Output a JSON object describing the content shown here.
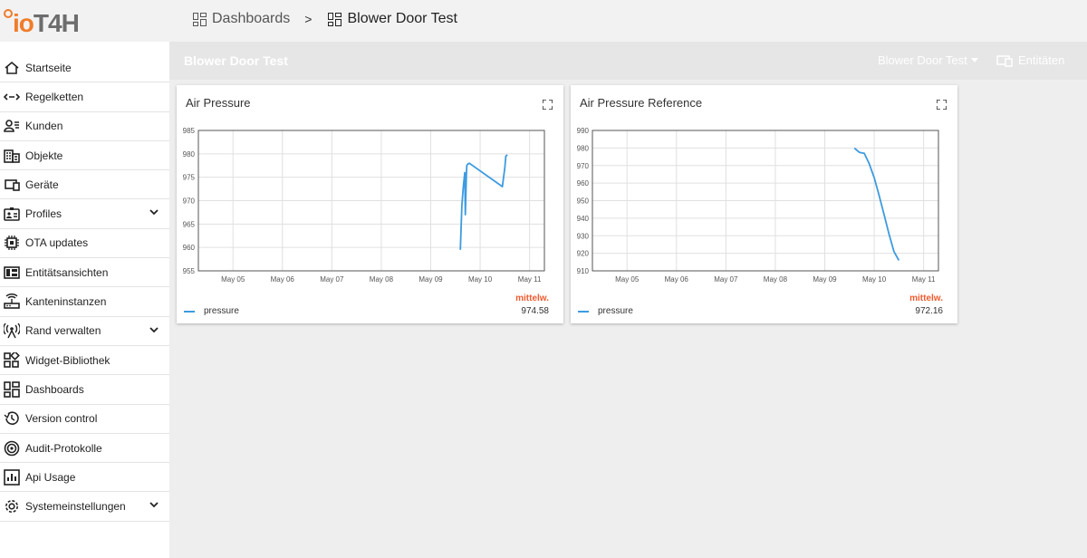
{
  "app": {
    "logo_text_a": "io",
    "logo_text_b": "T4H"
  },
  "breadcrumb": {
    "dashboards": "Dashboards",
    "separator": ">",
    "current": "Blower Door Test"
  },
  "sidebar": {
    "items": [
      {
        "label": "Startseite",
        "icon": "home-icon"
      },
      {
        "label": "Regelketten",
        "icon": "rule-chain-icon"
      },
      {
        "label": "Kunden",
        "icon": "customers-icon"
      },
      {
        "label": "Objekte",
        "icon": "building-icon"
      },
      {
        "label": "Geräte",
        "icon": "devices-icon"
      },
      {
        "label": "Profiles",
        "icon": "profiles-icon",
        "expandable": true
      },
      {
        "label": "OTA updates",
        "icon": "chip-icon"
      },
      {
        "label": "Entitätsansichten",
        "icon": "entity-view-icon"
      },
      {
        "label": "Kanteninstanzen",
        "icon": "router-icon"
      },
      {
        "label": "Rand verwalten",
        "icon": "antenna-icon",
        "expandable": true
      },
      {
        "label": "Widget-Bibliothek",
        "icon": "widgets-icon"
      },
      {
        "label": "Dashboards",
        "icon": "dashboard-icon"
      },
      {
        "label": "Version control",
        "icon": "history-icon"
      },
      {
        "label": "Audit-Protokolle",
        "icon": "track-icon"
      },
      {
        "label": "Api Usage",
        "icon": "bar-chart-icon"
      },
      {
        "label": "Systemeinstellungen",
        "icon": "settings-icon",
        "expandable": true
      }
    ]
  },
  "dashboard": {
    "title": "Blower Door Test",
    "state_selector": "Blower Door Test",
    "entities_button": "Entitäten"
  },
  "widgets": [
    {
      "title": "Air Pressure",
      "legend_header": "mittelw.",
      "legend_series": "pressure",
      "legend_value": "974.58"
    },
    {
      "title": "Air Pressure Reference",
      "legend_header": "mittelw.",
      "legend_series": "pressure",
      "legend_value": "972.16"
    }
  ],
  "colors": {
    "series": "#3d9be0",
    "accent": "#ef5b2f",
    "logo_orange": "#f07c2a"
  },
  "chart_data": [
    {
      "type": "line",
      "title": "Air Pressure",
      "categories": [
        "May 05",
        "May 06",
        "May 07",
        "May 08",
        "May 09",
        "May 10",
        "May 11"
      ],
      "ylim": [
        955,
        985
      ],
      "yticks": [
        955,
        960,
        965,
        970,
        975,
        980,
        985
      ],
      "xlim": [
        4.3,
        11.3
      ],
      "series": [
        {
          "name": "pressure",
          "x": [
            9.6,
            9.63,
            9.66,
            9.69,
            9.7,
            9.72,
            9.73,
            9.75,
            9.78,
            10.45,
            10.5,
            10.52,
            10.55
          ],
          "values": [
            959.5,
            969,
            973,
            976,
            967,
            975,
            977.5,
            977.8,
            978,
            973,
            977,
            979.5,
            979.8
          ]
        }
      ],
      "legend_avg": 974.58
    },
    {
      "type": "line",
      "title": "Air Pressure Reference",
      "categories": [
        "May 05",
        "May 06",
        "May 07",
        "May 08",
        "May 09",
        "May 10",
        "May 11"
      ],
      "ylim": [
        910,
        990
      ],
      "yticks": [
        910,
        920,
        930,
        940,
        950,
        960,
        970,
        980,
        990
      ],
      "xlim": [
        4.3,
        11.3
      ],
      "series": [
        {
          "name": "pressure",
          "x": [
            9.6,
            9.7,
            9.8,
            9.9,
            10.0,
            10.1,
            10.2,
            10.3,
            10.4,
            10.5
          ],
          "values": [
            980,
            977.5,
            977,
            971,
            963,
            953,
            942,
            931,
            921,
            916
          ]
        }
      ],
      "legend_avg": 972.16
    }
  ]
}
